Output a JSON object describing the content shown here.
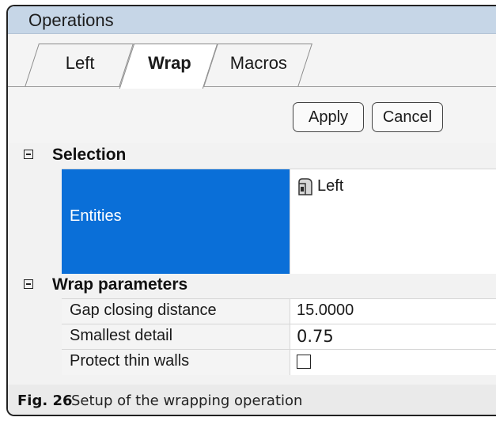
{
  "panel": {
    "title": "Operations"
  },
  "tabs": [
    {
      "label": "Left",
      "active": false
    },
    {
      "label": "Wrap",
      "active": true
    },
    {
      "label": "Macros",
      "active": false
    }
  ],
  "buttons": {
    "apply": "Apply",
    "cancel": "Cancel"
  },
  "selection": {
    "header": "Selection",
    "entities_label": "Entities",
    "entities_value": "Left",
    "entity_icon": "part-icon"
  },
  "wrap_parameters": {
    "header": "Wrap parameters",
    "rows": [
      {
        "label": "Gap closing distance",
        "value": "15.0000"
      },
      {
        "label": "Smallest detail",
        "value": "0.75"
      },
      {
        "label": "Protect thin walls",
        "checked": false
      }
    ]
  },
  "caption": {
    "prefix": "Fig. 26",
    "text": "Setup of the wrapping operation"
  },
  "colors": {
    "selected_row": "#0a6fd8",
    "titlebar": "#c6d6e7"
  }
}
